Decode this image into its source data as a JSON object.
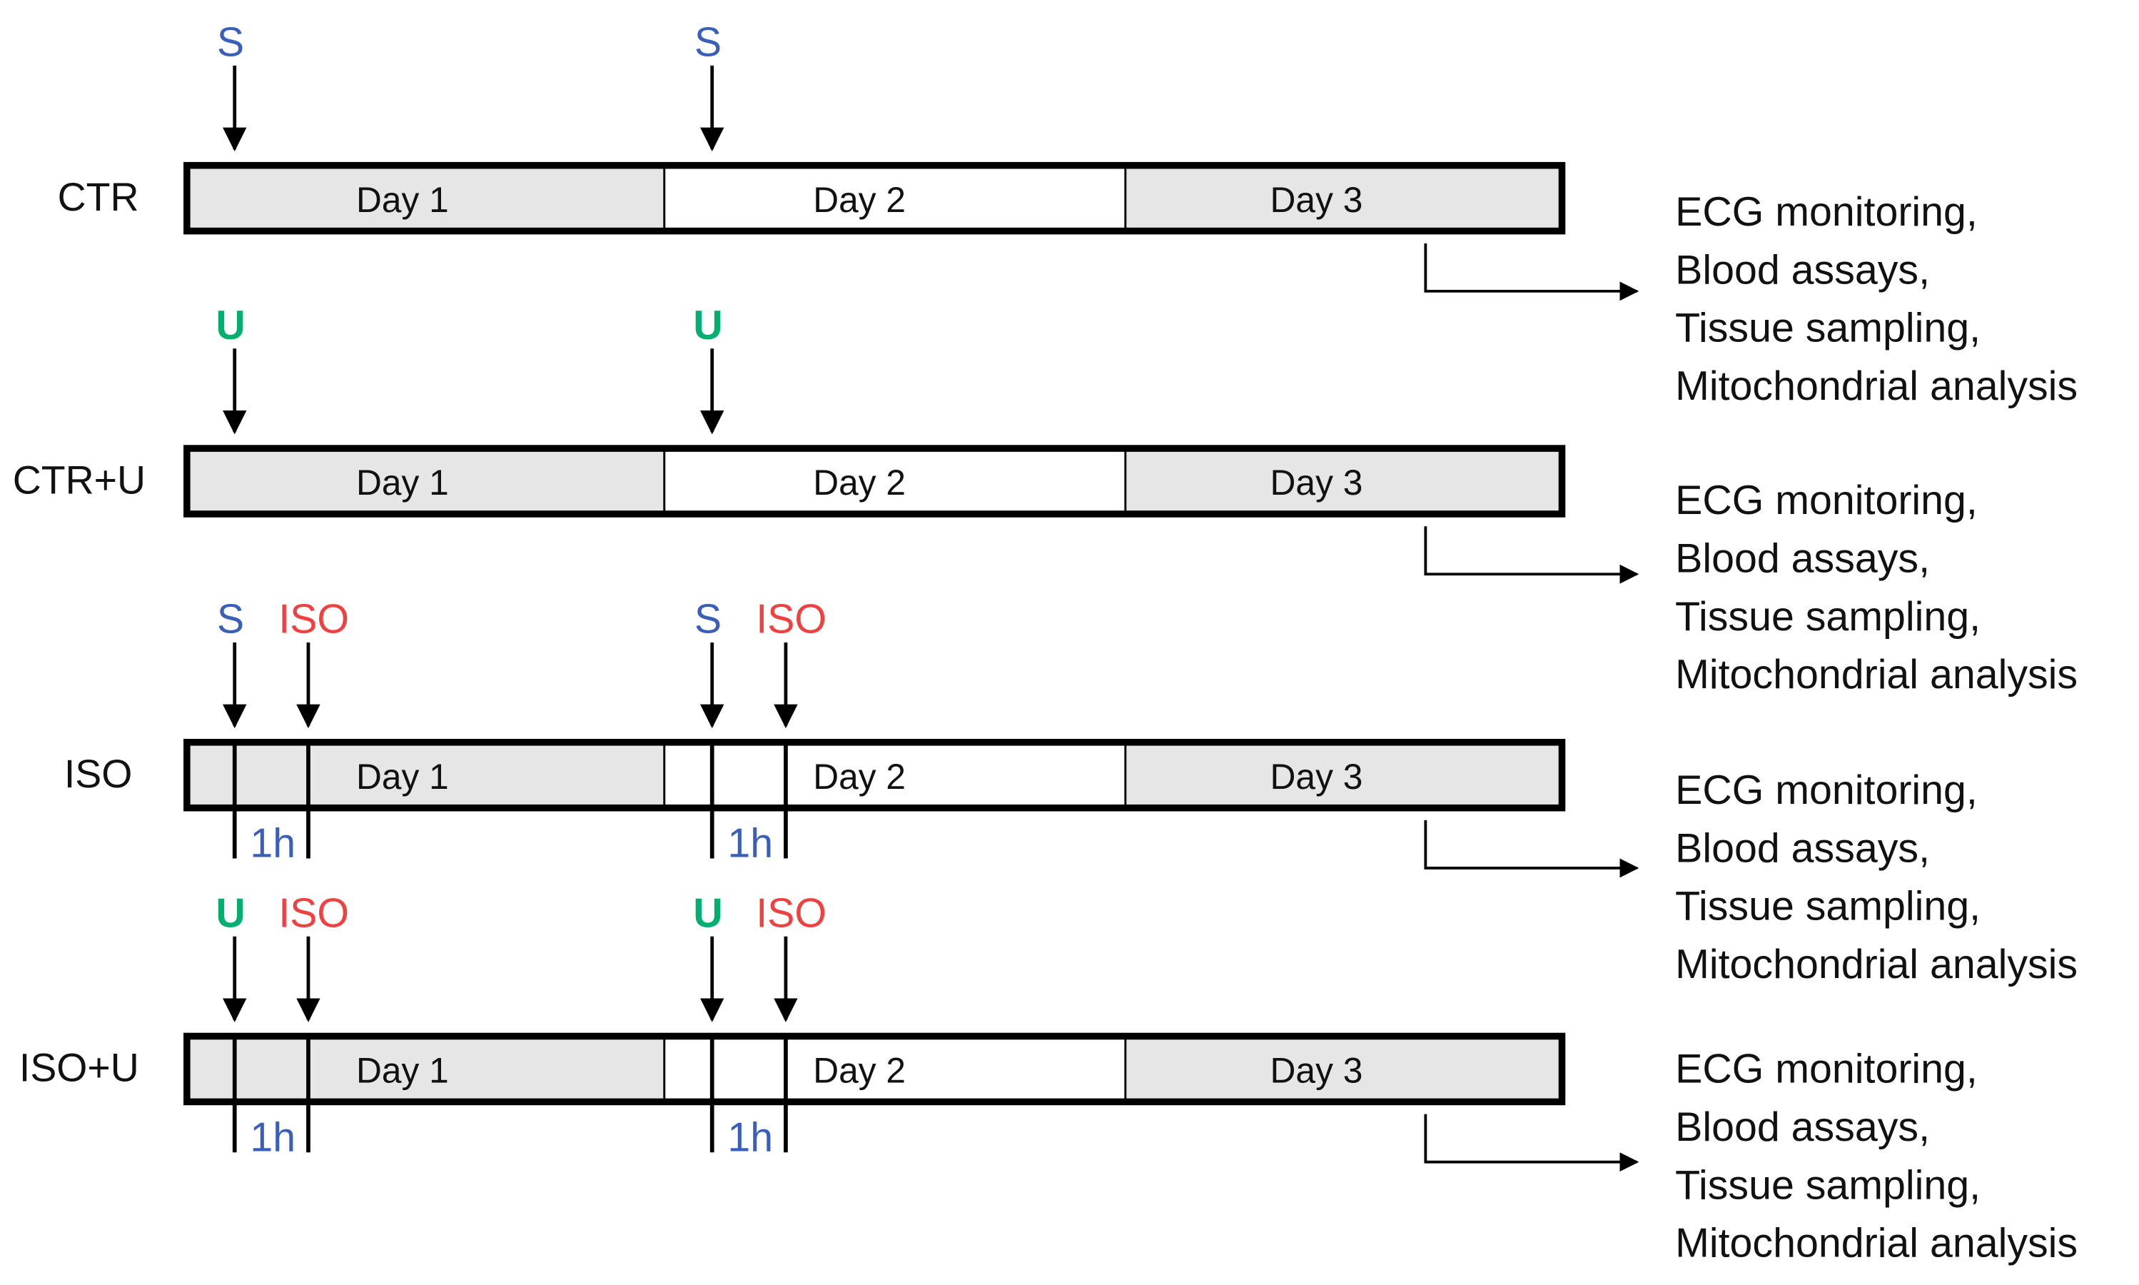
{
  "colors": {
    "saline": "#3a5fb8",
    "urolithin": "#00b070",
    "iso": "#f04040",
    "interval": "#3a5fb8",
    "day_fill_shaded": "#e6e6e6",
    "day_fill_plain": "#ffffff",
    "stroke": "#000000"
  },
  "groups": [
    {
      "label": "CTR",
      "days": [
        "Day 1",
        "Day 2",
        "Day 3"
      ],
      "markers": [
        [
          {
            "text": "S",
            "color": "saline"
          }
        ],
        [
          {
            "text": "S",
            "color": "saline"
          }
        ]
      ],
      "interval": null,
      "outcomes": [
        "ECG monitoring,",
        "Blood assays,",
        "Tissue sampling,",
        "Mitochondrial analysis"
      ]
    },
    {
      "label": "CTR+U",
      "days": [
        "Day 1",
        "Day 2",
        "Day 3"
      ],
      "markers": [
        [
          {
            "text": "U",
            "color": "urolithin"
          }
        ],
        [
          {
            "text": "U",
            "color": "urolithin"
          }
        ]
      ],
      "interval": null,
      "outcomes": [
        "ECG monitoring,",
        "Blood assays,",
        "Tissue sampling,",
        "Mitochondrial analysis"
      ]
    },
    {
      "label": "ISO",
      "days": [
        "Day 1",
        "Day 2",
        "Day 3"
      ],
      "markers": [
        [
          {
            "text": "S",
            "color": "saline"
          },
          {
            "text": "ISO",
            "color": "iso"
          }
        ],
        [
          {
            "text": "S",
            "color": "saline"
          },
          {
            "text": "ISO",
            "color": "iso"
          }
        ]
      ],
      "interval": "1h",
      "outcomes": [
        "ECG monitoring,",
        "Blood assays,",
        "Tissue sampling,",
        "Mitochondrial analysis"
      ]
    },
    {
      "label": "ISO+U",
      "days": [
        "Day 1",
        "Day 2",
        "Day 3"
      ],
      "markers": [
        [
          {
            "text": "U",
            "color": "urolithin"
          },
          {
            "text": "ISO",
            "color": "iso"
          }
        ],
        [
          {
            "text": "U",
            "color": "urolithin"
          },
          {
            "text": "ISO",
            "color": "iso"
          }
        ]
      ],
      "interval": "1h",
      "outcomes": [
        "ECG monitoring,",
        "Blood assays,",
        "Tissue sampling,",
        "Mitochondrial analysis"
      ]
    }
  ]
}
